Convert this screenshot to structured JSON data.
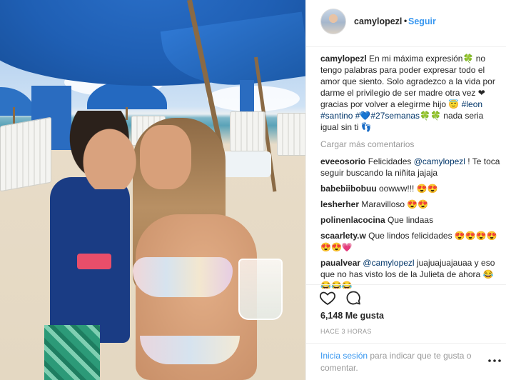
{
  "post": {
    "username": "camylopezl",
    "follow_label": "Seguir",
    "header_separator": "•"
  },
  "caption": {
    "username": "camylopezl",
    "text_1": "En mi máxima expresión",
    "symbol_1": "🍀",
    "text_2": " no tengo palabras para poder expresar todo el amor que siento. Solo agradezco a la vida por darme el privilegio de ser madre otra vez ",
    "symbol_2": "❤",
    "text_3": " gracias por volver a elegirme hijo ",
    "symbol_3": "😇",
    "tags": [
      "#leon",
      "#santino",
      "#💙",
      "#27semanas"
    ],
    "symbol_4": "🍀🍀",
    "text_4": " nada seria igual sin ti ",
    "symbol_5": "👣"
  },
  "load_more": "Cargar más comentarios",
  "comments": [
    {
      "user": "eveeosorio",
      "text_a": "Felicidades ",
      "mention": "@camylopezl",
      "text_b": " ! Te toca seguir buscando la niñita jajaja"
    },
    {
      "user": "babebiibobuu",
      "text_a": "oowww!!! ",
      "emoji": "😍😍"
    },
    {
      "user": "lesherher",
      "text_a": "Maravilloso ",
      "emoji": "😍😍"
    },
    {
      "user": "polinenlacocina",
      "text_a": "Que lindaas"
    },
    {
      "user": "scaarlety.w",
      "text_a": "Que lindos felicidades ",
      "emoji": "😍😍😍😍😍😍💗"
    },
    {
      "user": "paualvear",
      "text_a": "",
      "mention": "@camylopezl",
      "text_b": " juajuajuajauaa y eso que no has visto los de la Julieta de",
      "text_c": "ahora 😂😂😂😂"
    }
  ],
  "icons": {
    "like": "heart-icon",
    "comment": "comment-icon",
    "more": "more-options-icon"
  },
  "likes_text": "6,148 Me gusta",
  "time_ago": "HACE 3 HORAS",
  "login": {
    "link": "Inicia sesión",
    "text": " para indicar que te gusta o comentar."
  },
  "colors": {
    "link": "#3897f0",
    "hashtag": "#003569",
    "muted": "#999999",
    "text": "#262626"
  }
}
